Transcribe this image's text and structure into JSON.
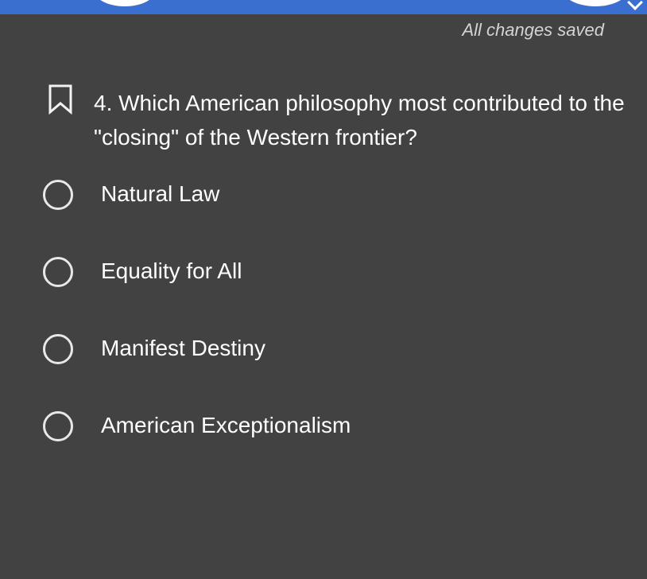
{
  "header": {
    "save_status": "All changes saved"
  },
  "question": {
    "number": "4.",
    "text": "4. Which American philosophy most contributed to the \"closing\" of the Western frontier?",
    "bookmark_icon": "bookmark-outline-icon"
  },
  "options": [
    {
      "label": "Natural Law",
      "selected": false
    },
    {
      "label": "Equality for All",
      "selected": false
    },
    {
      "label": "Manifest Destiny",
      "selected": false
    },
    {
      "label": "American Exceptionalism",
      "selected": false
    }
  ],
  "colors": {
    "background": "#424242",
    "topbar": "#3a6fcf",
    "text": "#ffffff",
    "muted_text": "#d4d4d4"
  }
}
